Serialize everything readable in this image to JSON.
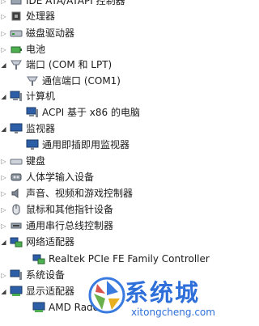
{
  "tree": {
    "items": [
      {
        "label": "IDE ATA/ATAPI 控制器",
        "icon": "ide-controller-icon",
        "expanded": false
      },
      {
        "label": "处理器",
        "icon": "processor-icon",
        "expanded": false
      },
      {
        "label": "磁盘驱动器",
        "icon": "disk-drive-icon",
        "expanded": false
      },
      {
        "label": "电池",
        "icon": "battery-icon",
        "expanded": false
      },
      {
        "label": "端口 (COM 和 LPT)",
        "icon": "port-icon",
        "expanded": true
      },
      {
        "label": "通信端口 (COM1)",
        "icon": "port-icon",
        "child": true
      },
      {
        "label": "计算机",
        "icon": "computer-icon",
        "expanded": true
      },
      {
        "label": "ACPI 基于 x86 的电脑",
        "icon": "computer-icon",
        "child": true
      },
      {
        "label": "监视器",
        "icon": "monitor-icon",
        "expanded": true
      },
      {
        "label": "通用即插即用监视器",
        "icon": "monitor-icon",
        "child": true
      },
      {
        "label": "键盘",
        "icon": "keyboard-icon",
        "expanded": false
      },
      {
        "label": "人体学输入设备",
        "icon": "hid-icon",
        "expanded": false
      },
      {
        "label": "声音、视频和游戏控制器",
        "icon": "speaker-icon",
        "expanded": false
      },
      {
        "label": "鼠标和其他指针设备",
        "icon": "mouse-icon",
        "expanded": false
      },
      {
        "label": "通用串行总线控制器",
        "icon": "usb-icon",
        "expanded": false
      },
      {
        "label": "网络适配器",
        "icon": "network-icon",
        "expanded": true
      },
      {
        "label": "Realtek PCIe FE Family Controller",
        "icon": "network-icon",
        "child": true
      },
      {
        "label": "系统设备",
        "icon": "system-device-icon",
        "expanded": false
      },
      {
        "label": "显示适配器",
        "icon": "display-adapter-icon",
        "expanded": true
      },
      {
        "label": "AMD Radeon",
        "icon": "display-adapter-icon",
        "child": true
      }
    ]
  },
  "watermark": {
    "brand": "系统城",
    "url": "xitongcheng.com"
  }
}
